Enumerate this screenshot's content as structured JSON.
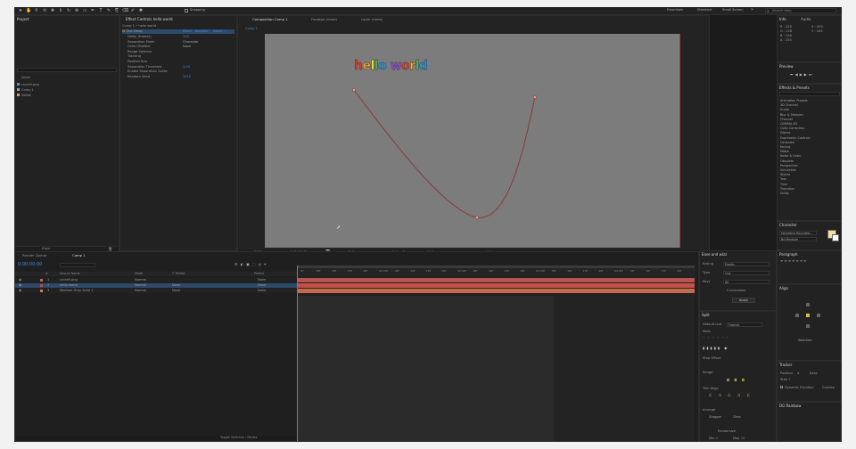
{
  "toolbar": {
    "tools": [
      "selection-tool-icon",
      "hand-tool-icon",
      "zoom-tool-icon",
      "orbit-camera-icon",
      "pan-camera-icon",
      "dolly-camera-icon",
      "rotate-tool-icon",
      "pan-behind-icon",
      "rectangle-tool-icon",
      "pen-tool-icon",
      "type-tool-icon",
      "brush-tool-icon",
      "clone-stamp-icon",
      "eraser-icon",
      "roto-brush-icon",
      "puppet-pin-icon"
    ],
    "snapping_label": "Snapping",
    "workspaces": [
      "Essentials",
      "Standard",
      "Small Screen"
    ],
    "search_placeholder": "Search Help"
  },
  "project_panel": {
    "tab": "Project",
    "name_header": "Name",
    "items": [
      "circle9.png",
      "Comp 1",
      "Solids"
    ],
    "footer_label": "8 bpc"
  },
  "effect_controls": {
    "tab": "Effect Controls  hello world",
    "comp_label": "Comp 1 • hello world",
    "text_label": "Text Delay",
    "reset_label": "Reset",
    "register_label": "Register",
    "about_label": "About...",
    "rows": [
      {
        "label": "Delay (frames)",
        "value": "100"
      },
      {
        "label": "Separation Mode",
        "value": "Character"
      },
      {
        "label": "Order Modifier",
        "value": "None"
      },
      {
        "label": "Range Selector",
        "value": ""
      },
      {
        "label": "Tracking",
        "value": ""
      },
      {
        "label": "Position Blur",
        "value": ""
      },
      {
        "label": "Separation Threshold",
        "value": "1.00"
      },
      {
        "label": "Enable Separation Guide",
        "value": ""
      },
      {
        "label": "Random Seed",
        "value": "1010"
      }
    ]
  },
  "viewer": {
    "tabs": [
      "Composition Comp 1",
      "Footage (none)",
      "Layer (none)"
    ],
    "sub_tab": "Comp 1",
    "comp_text": "hello world",
    "letter_colors": [
      "#e23b2e",
      "#f2a52a",
      "#f2d930",
      "#3bb552",
      "#2f8fd6",
      "#8a4fd1",
      "#e23b2e",
      "#f2a52a",
      "#3bb552",
      "#2f8fd6",
      "#8a4fd1"
    ],
    "zoom": "100%",
    "timecode": "0:00:00:00",
    "resolution": "Full",
    "camera": "Active Camera",
    "views": "1 View",
    "exposure": "+0.0"
  },
  "info_panel": {
    "tabs": [
      "Info",
      "Audio"
    ],
    "r_label": "R :",
    "r_value": "128",
    "g_label": "G :",
    "g_value": "128",
    "b_label": "B :",
    "b_value": "128",
    "a_label": "A :",
    "a_value": "255",
    "x_label": "X :",
    "x_value": "493",
    "y_label": "Y :",
    "y_value": "343"
  },
  "preview_panel": {
    "tab": "Preview"
  },
  "effects_presets": {
    "tab": "Effects & Presets",
    "search_placeholder": "",
    "categories": [
      "Animation Presets",
      "3D Channel",
      "Audio",
      "Blur & Sharpen",
      "Channel",
      "CINEMA 4D",
      "Color Correction",
      "Distort",
      "Expression Controls",
      "Generate",
      "Keying",
      "Matte",
      "Noise & Grain",
      "Obsolete",
      "Perspective",
      "Simulation",
      "Stylize",
      "Text",
      "Time",
      "Transition",
      "Utility"
    ]
  },
  "character_panel": {
    "tab": "Character",
    "font": "Helvetica Rounded...",
    "style": "Bd Medium"
  },
  "paragraph_panel": {
    "tab": "Paragraph"
  },
  "align_panel": {
    "tab": "Align",
    "align_to": "Selection"
  },
  "easing_panel": {
    "tab": "Ease and wizz",
    "easing_label": "Easing",
    "easing_value": "Elastic",
    "type_label": "Type",
    "type_value": "Out",
    "keys_label": "Keys",
    "keys_value": "All",
    "curvaceous_label": "Curvaceous",
    "apply_label": "Apply"
  },
  "split_panel": {
    "tab": "Split",
    "default_unit_label": "Default unit",
    "default_unit": "Frames",
    "slots_label": "Slots",
    "shift_label": "Step Offset",
    "range_label": "Range",
    "trim_label": "Trim Align",
    "arrange_label": "Arrange",
    "stagger_label": "Stagger",
    "stagger_value": "Desc",
    "randomize_label": "Randomize",
    "min_label": "Min",
    "min_value": "0",
    "max_label": "Max",
    "max_value": "30"
  },
  "tracker_panel": {
    "tab": "Tracker",
    "motion_label": "Position",
    "x_label": "X",
    "dir_value": "Desc",
    "step_label": "Step",
    "step_value": "1",
    "dynamic_label": "Dynamic Duration",
    "overlap_label": "Overlap"
  },
  "dg_panel": {
    "tab": "DG Rainbow"
  },
  "timeline": {
    "tabs": [
      "Render Queue",
      "Comp 1"
    ],
    "timecode": "0:00:00:00",
    "columns": [
      "#",
      "Source Name",
      "Mode",
      "T TrkMat",
      "Parent"
    ],
    "layers": [
      {
        "num": "1",
        "name": "circle9.png",
        "mode": "Normal",
        "trkmat": "",
        "parent": "None",
        "color": "#c46262"
      },
      {
        "num": "2",
        "name": "hello world",
        "mode": "Normal",
        "trkmat": "None",
        "parent": "None",
        "color": "#c44a4a"
      },
      {
        "num": "3",
        "name": "Medium Gray Solid 1",
        "mode": "Normal",
        "trkmat": "None",
        "parent": "None",
        "color": "#c47f4a"
      }
    ],
    "ruler_labels": [
      "0f",
      "05f",
      "10f",
      "15f",
      "20f",
      "01:00f",
      "05f",
      "10f",
      "15f",
      "20f",
      "02:00f",
      "05f",
      "10f",
      "15f",
      "20f",
      "03:00f",
      "05f",
      "10f",
      "15f",
      "20f",
      "04:00f",
      "05f",
      "10f",
      "15f",
      "20f"
    ],
    "toggle_label": "Toggle Switches / Modes"
  }
}
